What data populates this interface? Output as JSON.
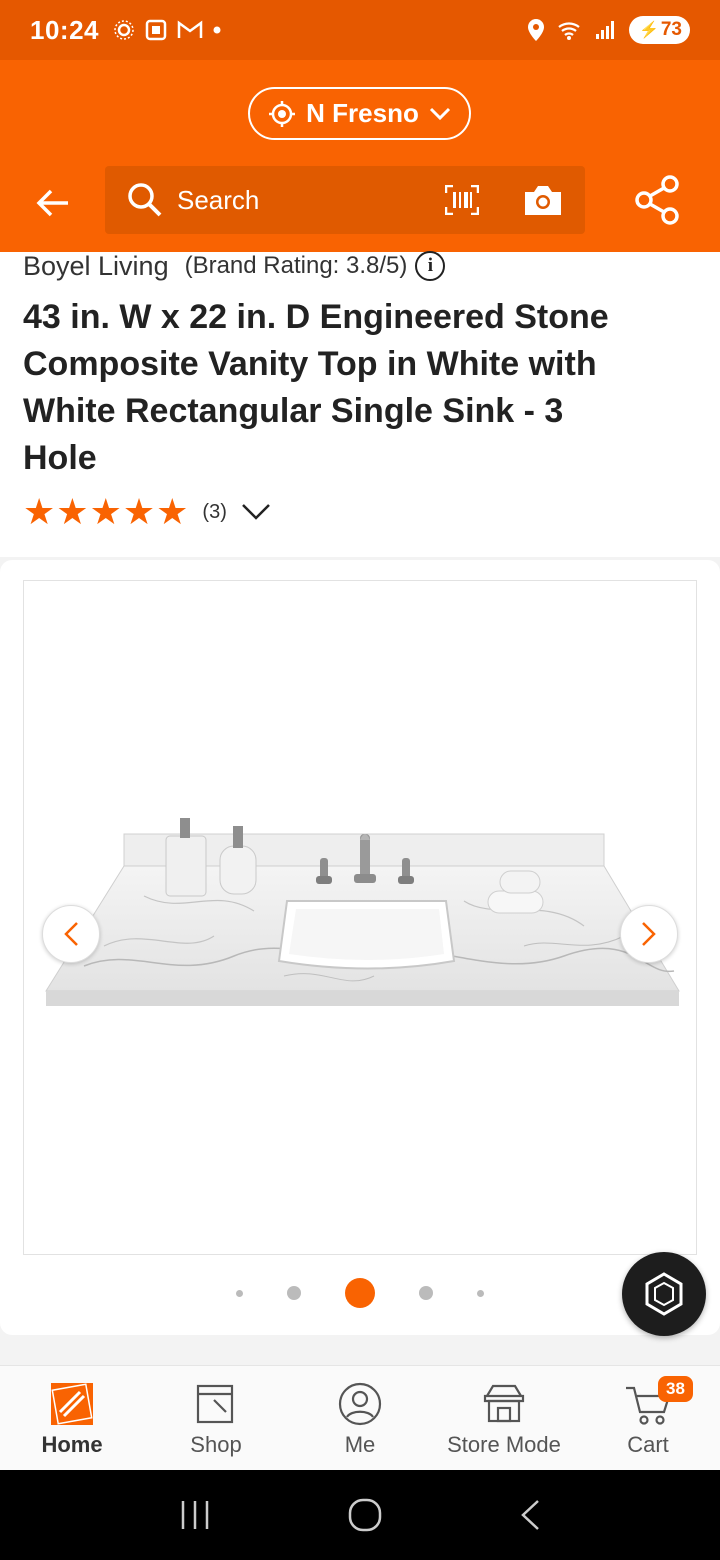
{
  "status_bar": {
    "time": "10:24",
    "battery": "73"
  },
  "header": {
    "location": "N Fresno",
    "search_placeholder": "Search"
  },
  "product": {
    "brand": "Boyel Living",
    "brand_rating": "(Brand Rating: 3.8/5)",
    "title": "43 in. W x 22 in. D Engineered Stone Composite Vanity Top in White with White Rectangular Single Sink - 3 Hole",
    "rating_stars": 5,
    "review_count": "(3)"
  },
  "gallery": {
    "image_count": 5,
    "active_index": 2
  },
  "bottom_nav": {
    "items": [
      {
        "label": "Home",
        "icon": "home-depot-logo-icon"
      },
      {
        "label": "Shop",
        "icon": "shop-icon"
      },
      {
        "label": "Me",
        "icon": "user-icon"
      },
      {
        "label": "Store Mode",
        "icon": "store-icon"
      },
      {
        "label": "Cart",
        "icon": "cart-icon"
      }
    ],
    "cart_count": "38"
  },
  "colors": {
    "brand_orange": "#f96302",
    "status_orange": "#e55800"
  }
}
